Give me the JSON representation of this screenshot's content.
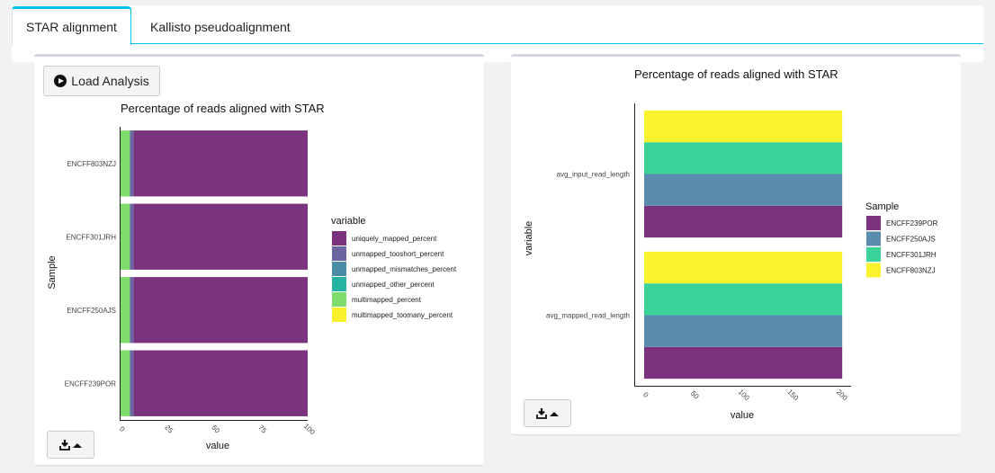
{
  "tabs": [
    {
      "label": "STAR alignment",
      "active": true
    },
    {
      "label": "Kallisto pseudoalignment",
      "active": false
    }
  ],
  "left_panel": {
    "load_button_label": "Load Analysis"
  },
  "colors": {
    "accent": "#00c0ef",
    "uniquely_mapped_percent": "#7b3380",
    "unmapped_tooshort_percent": "#6a67a0",
    "unmapped_mismatches_percent": "#4a8ca6",
    "unmapped_other_percent": "#27b3a1",
    "multimapped_percent": "#7ddc6a",
    "multimapped_toomany_percent": "#f9ef2a",
    "ENCFF239POR": "#7b3380",
    "ENCFF250AJS": "#5b8caf",
    "ENCFF301JRH": "#3ad49a",
    "ENCFF803NZJ": "#faf22f"
  },
  "chart_data": [
    {
      "type": "bar",
      "orientation": "horizontal",
      "stacked": true,
      "title": "Percentage of reads aligned with STAR",
      "xlabel": "value",
      "ylabel": "Sample",
      "xlim": [
        0,
        100
      ],
      "x_ticks": [
        "0",
        "25",
        "50",
        "75",
        "100"
      ],
      "categories": [
        "ENCFF239POR",
        "ENCFF250AJS",
        "ENCFF301JRH",
        "ENCFF803NZJ"
      ],
      "legend_title": "variable",
      "legend_position": "right",
      "series": [
        {
          "name": "multimapped_toomany_percent",
          "values": [
            0,
            0,
            0,
            0
          ]
        },
        {
          "name": "multimapped_percent",
          "values": [
            5,
            5,
            5,
            5
          ]
        },
        {
          "name": "unmapped_other_percent",
          "values": [
            0,
            0,
            0,
            0
          ]
        },
        {
          "name": "unmapped_mismatches_percent",
          "values": [
            0,
            0,
            0,
            0
          ]
        },
        {
          "name": "unmapped_tooshort_percent",
          "values": [
            2,
            2,
            2,
            2
          ]
        },
        {
          "name": "uniquely_mapped_percent",
          "values": [
            93,
            93,
            93,
            93
          ]
        }
      ]
    },
    {
      "type": "bar",
      "orientation": "horizontal",
      "grouped": true,
      "title": "Percentage of reads aligned with STAR",
      "xlabel": "value",
      "ylabel": "variable",
      "xlim": [
        0,
        200
      ],
      "x_ticks": [
        "0",
        "50",
        "100",
        "150",
        "200"
      ],
      "categories": [
        "avg_mapped_read_length",
        "avg_input_read_length"
      ],
      "legend_title": "Sample",
      "legend_position": "right",
      "series": [
        {
          "name": "ENCFF239POR",
          "values": [
            202,
            202
          ]
        },
        {
          "name": "ENCFF250AJS",
          "values": [
            202,
            202
          ]
        },
        {
          "name": "ENCFF301JRH",
          "values": [
            202,
            202
          ]
        },
        {
          "name": "ENCFF803NZJ",
          "values": [
            202,
            202
          ]
        }
      ]
    }
  ]
}
